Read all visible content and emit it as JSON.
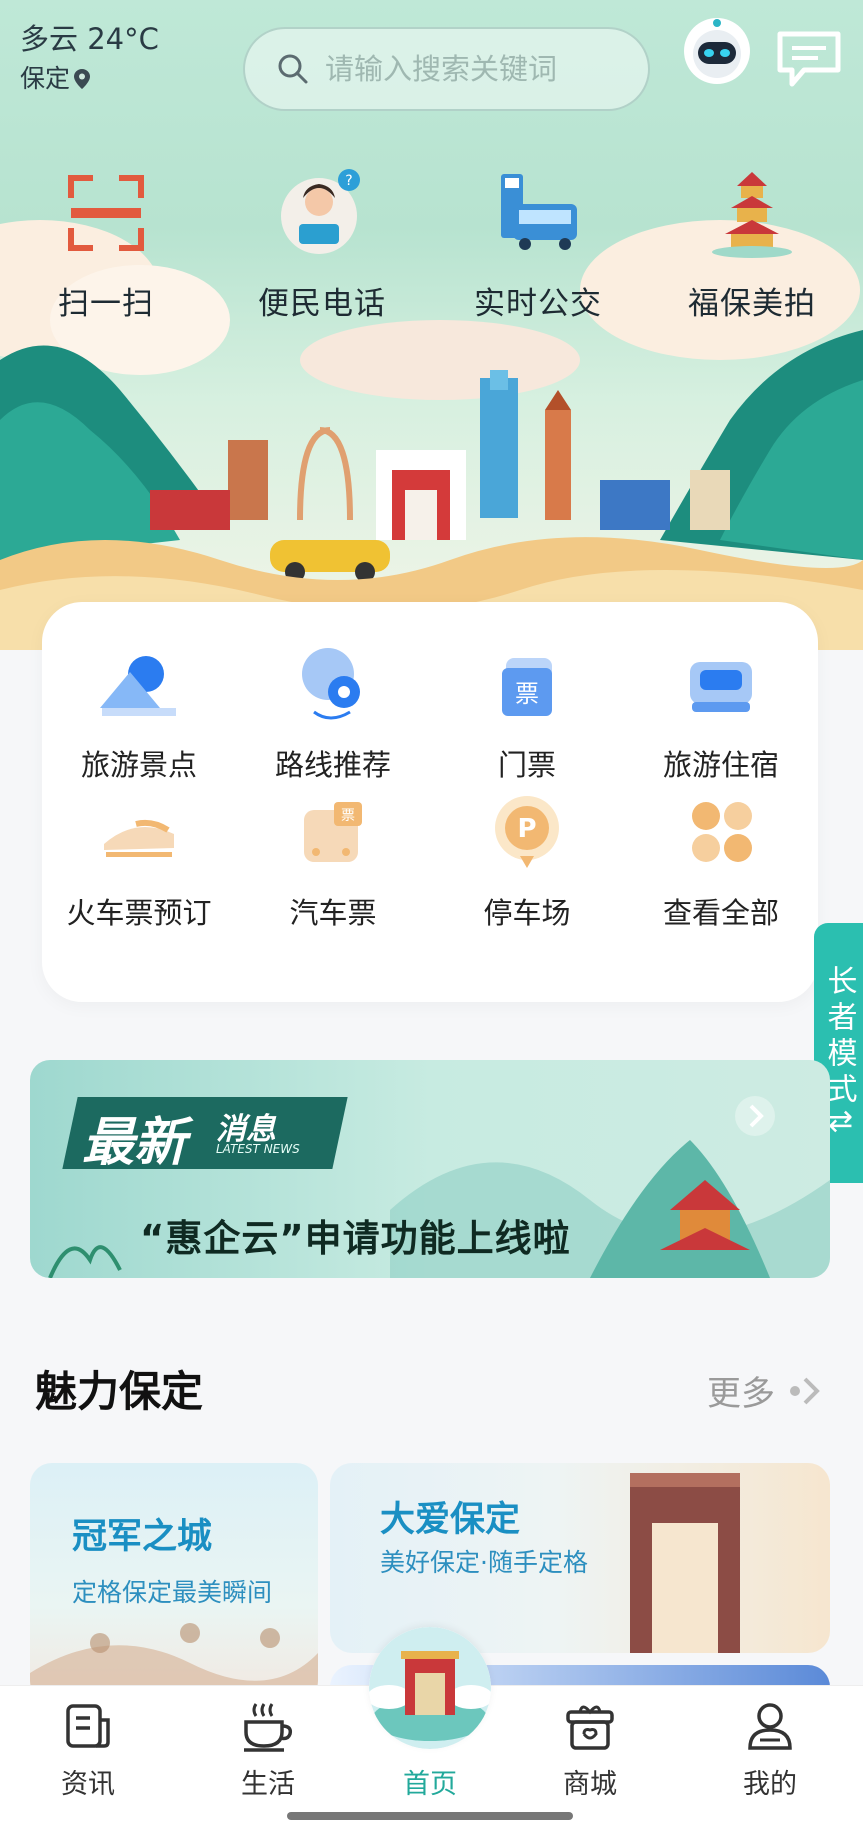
{
  "header": {
    "weather": "多云 24°C",
    "city": "保定",
    "search_placeholder": "请输入搜索关键词"
  },
  "quick_actions": [
    {
      "label": "扫一扫",
      "icon": "scan-icon"
    },
    {
      "label": "便民电话",
      "icon": "customer-service-icon"
    },
    {
      "label": "实时公交",
      "icon": "bus-icon"
    },
    {
      "label": "福保美拍",
      "icon": "pagoda-icon"
    }
  ],
  "services": [
    {
      "label": "旅游景点",
      "icon": "mountain-icon"
    },
    {
      "label": "路线推荐",
      "icon": "route-pin-icon"
    },
    {
      "label": "门票",
      "icon": "ticket-icon",
      "icon_text": "票"
    },
    {
      "label": "旅游住宿",
      "icon": "sofa-icon"
    },
    {
      "label": "火车票预订",
      "icon": "train-icon"
    },
    {
      "label": "汽车票",
      "icon": "bus-ticket-icon",
      "icon_text": "票"
    },
    {
      "label": "停车场",
      "icon": "parking-icon",
      "icon_text": "P"
    },
    {
      "label": "查看全部",
      "icon": "clover-grid-icon"
    }
  ],
  "elder_mode": "长者模式⇅",
  "news": {
    "badge_main": "最新",
    "badge_sub": "消息",
    "badge_en": "LATEST NEWS",
    "headline": "“惠企云”申请功能上线啦"
  },
  "section": {
    "title": "魅力保定",
    "more": "更多"
  },
  "tiles": [
    {
      "title": "冠军之城",
      "subtitle": "定格保定最美瞬间"
    },
    {
      "title": "大爱保定",
      "subtitle": "美好保定·随手定格"
    }
  ],
  "tabs": [
    {
      "label": "资讯",
      "icon": "news-icon"
    },
    {
      "label": "生活",
      "icon": "coffee-icon"
    },
    {
      "label": "首页",
      "icon": "home-gate-icon",
      "active": true
    },
    {
      "label": "商城",
      "icon": "shop-icon"
    },
    {
      "label": "我的",
      "icon": "user-icon"
    }
  ],
  "colors": {
    "accent": "#22a99b",
    "elder_bg": "#2bbfb0",
    "tile_title": "#1a8fc3"
  }
}
